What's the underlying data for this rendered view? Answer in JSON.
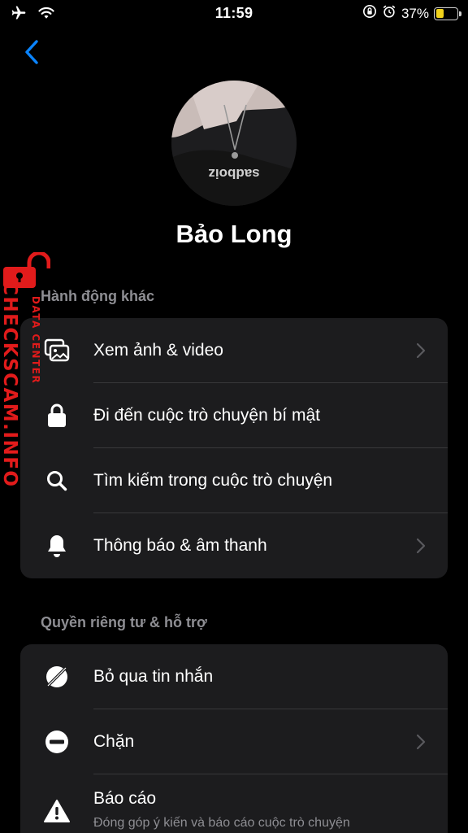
{
  "status_bar": {
    "time": "11:59",
    "battery_percent": "37%",
    "battery_level": 0.37,
    "icons": [
      "airplane-icon",
      "wifi-icon",
      "orientation-lock-icon",
      "alarm-icon",
      "battery-icon"
    ]
  },
  "header": {
    "back_icon": "chevron-left-icon"
  },
  "profile": {
    "name": "Bảo Long",
    "avatar_caption": "sadboiz"
  },
  "sections": {
    "actions": {
      "title": "Hành động khác",
      "items": [
        {
          "label": "Xem ảnh & video",
          "icon": "photos-icon",
          "chevron": true
        },
        {
          "label": "Đi đến cuộc trò chuyện bí mật",
          "icon": "lock-icon",
          "chevron": false
        },
        {
          "label": "Tìm kiếm trong cuộc trò chuyện",
          "icon": "search-icon",
          "chevron": false
        },
        {
          "label": "Thông báo & âm thanh",
          "icon": "bell-icon",
          "chevron": true
        }
      ]
    },
    "privacy": {
      "title": "Quyền riêng tư & hỗ trợ",
      "items": [
        {
          "label": "Bỏ qua tin nhắn",
          "icon": "ignore-icon",
          "chevron": false
        },
        {
          "label": "Chặn",
          "icon": "block-icon",
          "chevron": true
        },
        {
          "label": "Báo cáo",
          "sublabel": "Đóng góp ý kiến và báo cáo cuộc trò chuyện",
          "icon": "warning-icon",
          "chevron": false
        }
      ]
    }
  },
  "watermark": {
    "main": "CHECKSCAM.INFO",
    "sub": "DATA CENTER"
  },
  "colors": {
    "background": "#000000",
    "card": "#1c1c1e",
    "accent": "#0a84ff",
    "secondary_text": "#8e8e93",
    "watermark": "#e11b1b"
  }
}
